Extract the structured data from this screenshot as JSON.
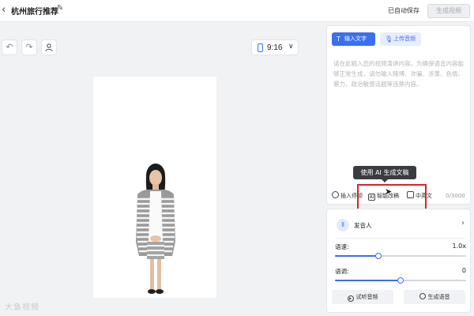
{
  "header": {
    "back_icon": "chevron-left-icon",
    "title": "杭州旅行推荐",
    "edit_icon": "pencil-icon",
    "autosave": "已自动保存",
    "generate_video": "生成视频"
  },
  "toolbar": {
    "undo_icon": "undo-icon",
    "redo_icon": "redo-icon",
    "avatar_icon": "person-icon",
    "ratio": "9:16"
  },
  "watermark": "大鱼视频",
  "editor": {
    "tabs": [
      {
        "label": "输入文字",
        "icon": "text-icon",
        "active": true
      },
      {
        "label": "上传音频",
        "icon": "microphone-icon",
        "active": false
      }
    ],
    "placeholder": "请在此输入您的视频演讲内容。为确保语音内容能够正常生成，请勿输入赌博、诈骗、涉黄、色情、暴力、政治敏感话题等违禁内容。",
    "tooltip": "使用 AI 生成文稿",
    "tools": {
      "insert_pause": "插入停顿",
      "smart_write": "智能改稿",
      "chinese_english": "中英文"
    },
    "char_count": "0/3000"
  },
  "voice": {
    "speaker_label": "发音人",
    "speed_label": "语速:",
    "speed_value": "1.0x",
    "speed_fraction": 0.33,
    "pitch_label": "语调:",
    "pitch_value": "0",
    "pitch_fraction": 0.5,
    "listen_button": "试听音频",
    "generate_voice_button": "生成语音"
  },
  "colors": {
    "accent": "#3b6ff0",
    "highlight": "#d1272c"
  }
}
